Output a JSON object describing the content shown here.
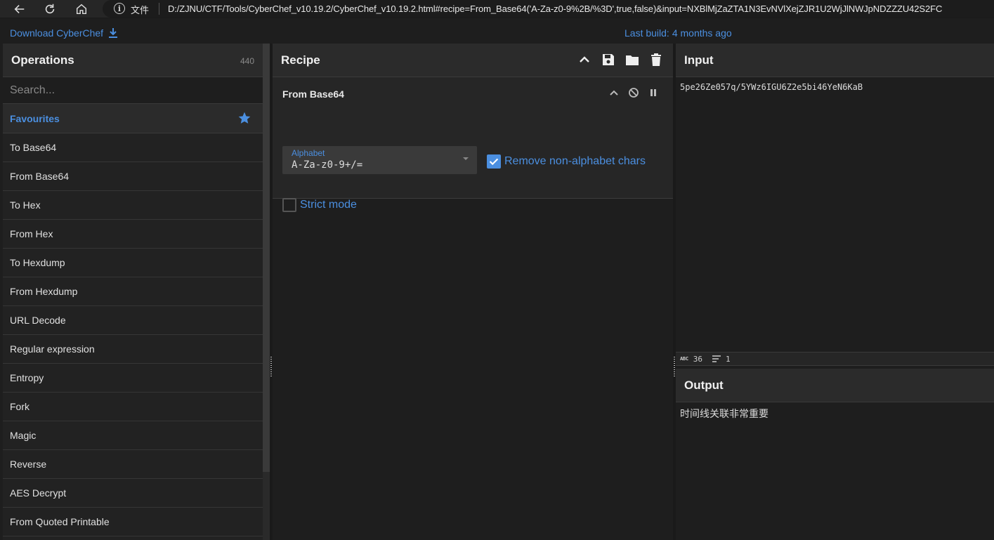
{
  "browser": {
    "file_label": "文件",
    "url": "D:/ZJNU/CTF/Tools/CyberChef_v10.19.2/CyberChef_v10.19.2.html#recipe=From_Base64('A-Za-z0-9%2B/%3D',true,false)&input=NXBlMjZaZTA1N3EvNVlXejZJR1U2WjJlNWJpNDZZZU42S2FC"
  },
  "banner": {
    "download_label": "Download CyberChef",
    "last_build_label": "Last build:",
    "last_build_value": "4 months ago"
  },
  "operations": {
    "title": "Operations",
    "count": "440",
    "search_placeholder": "Search...",
    "favourites_label": "Favourites",
    "items": [
      "To Base64",
      "From Base64",
      "To Hex",
      "From Hex",
      "To Hexdump",
      "From Hexdump",
      "URL Decode",
      "Regular expression",
      "Entropy",
      "Fork",
      "Magic",
      "Reverse",
      "AES Decrypt",
      "From Quoted Printable"
    ]
  },
  "recipe": {
    "title": "Recipe",
    "operation": {
      "title": "From Base64",
      "alphabet_label": "Alphabet",
      "alphabet_value": "A-Za-z0-9+/=",
      "remove_nonalpha_label": "Remove non-alphabet chars",
      "remove_nonalpha_checked": true,
      "strict_mode_label": "Strict mode",
      "strict_mode_checked": false
    }
  },
  "input": {
    "title": "Input",
    "text": "5pe26Ze057q/5YWz6IGU6Z2e5bi46YeN6KaB",
    "char_count": "36",
    "line_count": "1"
  },
  "output": {
    "title": "Output",
    "text": "时间线关联非常重要"
  },
  "colors": {
    "accent": "#4b8fe0",
    "background": "#1e1e1e",
    "header": "#2b2b2b"
  }
}
